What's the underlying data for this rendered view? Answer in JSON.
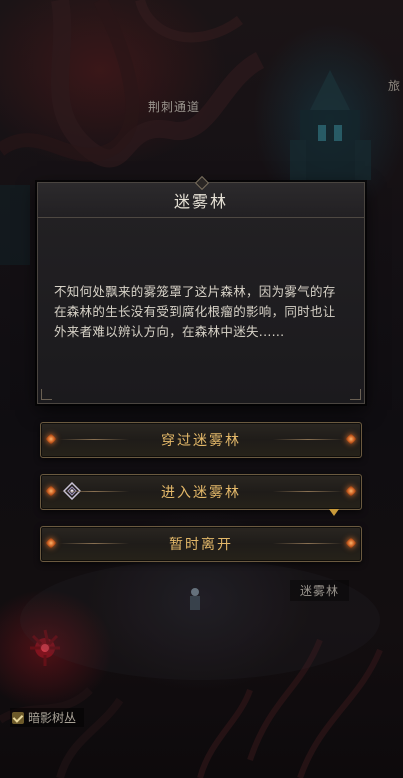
{
  "map": {
    "label_passage": "荆刺通道",
    "label_mistwood": "迷雾林",
    "label_edge": "旅",
    "shadow_grove": "暗影树丛"
  },
  "dialog": {
    "title": "迷雾林",
    "description": "不知何处飘来的雾笼罩了这片森林，因为雾气的存在森林的生长没有受到腐化根瘤的影响，同时也让外来者难以辨认方向，在森林中迷失......"
  },
  "choices": [
    {
      "label": "穿过迷雾林"
    },
    {
      "label": "进入迷雾林",
      "icon": "route-marker-icon"
    },
    {
      "label": "暂时离开"
    }
  ],
  "colors": {
    "accent": "#e3b869",
    "gem": "#ff8a3a",
    "text": "#d8d3c8"
  }
}
